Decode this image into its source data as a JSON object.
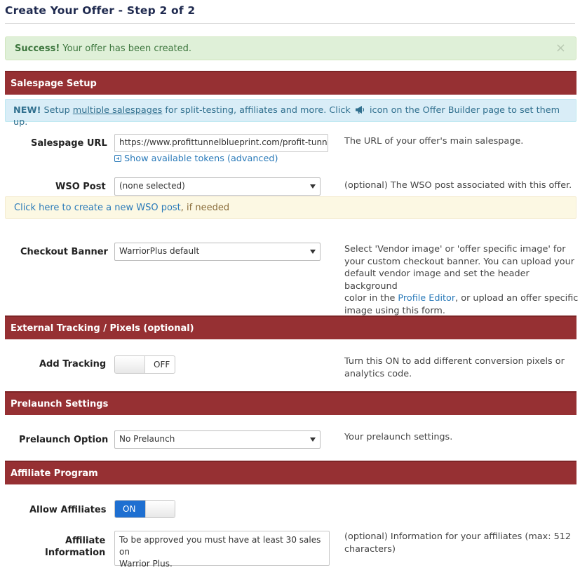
{
  "page": {
    "title": "Create Your Offer - Step 2 of 2"
  },
  "success_alert": {
    "strong": "Success!",
    "message": " Your offer has been created.",
    "close": "×"
  },
  "sections": {
    "salespage": "Salespage Setup",
    "tracking": "External Tracking / Pixels (optional)",
    "prelaunch": "Prelaunch Settings",
    "affiliate": "Affiliate Program"
  },
  "info_alert": {
    "strong": "NEW!",
    "pre": " Setup ",
    "link": "multiple salespages",
    "post": " for split-testing, affiliates and more. Click ",
    "icon": "megaphone-icon",
    "post2": " icon on the Offer Builder page to set them up."
  },
  "salespage_url": {
    "label": "Salespage URL",
    "value": "https://www.profittunnelblueprint.com/profit-tunnel-sales",
    "tokens_link": "Show available tokens (advanced)",
    "help": "The URL of your offer's main salespage."
  },
  "wso_post": {
    "label": "WSO Post",
    "selected": "(none selected)",
    "help": "(optional) The WSO post associated with this offer.",
    "create_link": "Click here to create a new WSO post",
    "create_suffix": ", if needed"
  },
  "checkout_banner": {
    "label": "Checkout Banner",
    "selected": "WarriorPlus default",
    "help_1": "Select 'Vendor image' or 'offer specific image' for",
    "help_2": "your custom checkout banner. You can upload your",
    "help_3": "default vendor image and set the header background",
    "help_4a": "color in the ",
    "help_4_link": "Profile Editor",
    "help_4b": ", or upload an offer specific",
    "help_5": "image using this form."
  },
  "add_tracking": {
    "label": "Add Tracking",
    "state": "OFF",
    "help_1": "Turn this ON to add different conversion pixels or",
    "help_2": "analytics code."
  },
  "prelaunch_option": {
    "label": "Prelaunch Option",
    "selected": "No Prelaunch",
    "help": "Your prelaunch settings."
  },
  "allow_affiliates": {
    "label": "Allow Affiliates",
    "state": "ON"
  },
  "affiliate_info": {
    "label_1": "Affiliate",
    "label_2": "Information",
    "value_1": "To be approved you must have at least 30 sales on",
    "value_2": "Warrior Plus.",
    "help_1": "(optional) Information for your affiliates (max: 512",
    "help_2": "characters)"
  },
  "colors": {
    "section_header": "#963033",
    "success_bg": "#dff0d8",
    "info_bg": "#d9edf7",
    "warning_bg": "#fcf8e3",
    "toggle_on": "#1e6fd1",
    "link": "#2a7ab9"
  }
}
